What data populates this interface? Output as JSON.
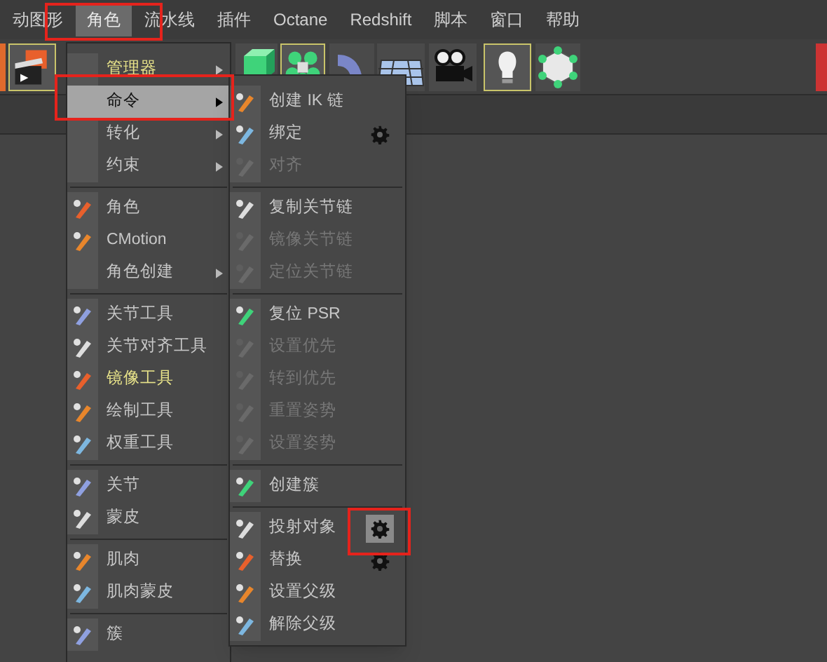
{
  "menubar": [
    {
      "label": "动图形",
      "selected": false
    },
    {
      "label": "角色",
      "selected": true
    },
    {
      "label": "流水线",
      "selected": false
    },
    {
      "label": "插件",
      "selected": false
    },
    {
      "label": "Octane",
      "selected": false
    },
    {
      "label": "Redshift",
      "selected": false
    },
    {
      "label": "脚本",
      "selected": false
    },
    {
      "label": "窗口",
      "selected": false
    },
    {
      "label": "帮助",
      "selected": false
    }
  ],
  "character_menu": [
    {
      "kind": "submenu",
      "label": "管理器",
      "selected": false,
      "accent": true
    },
    {
      "kind": "submenu",
      "label": "命令",
      "selected": true,
      "accent": false
    },
    {
      "kind": "submenu",
      "label": "转化",
      "selected": false,
      "accent": false
    },
    {
      "kind": "submenu",
      "label": "约束",
      "selected": false,
      "accent": false
    },
    {
      "kind": "separator"
    },
    {
      "kind": "command",
      "label": "角色",
      "selected": false,
      "accent": false
    },
    {
      "kind": "command",
      "label": "CMotion",
      "selected": false,
      "accent": false
    },
    {
      "kind": "submenu",
      "label": "角色创建",
      "selected": false,
      "accent": false
    },
    {
      "kind": "separator"
    },
    {
      "kind": "command",
      "label": "关节工具",
      "selected": false,
      "accent": false
    },
    {
      "kind": "command",
      "label": "关节对齐工具",
      "selected": false,
      "accent": false
    },
    {
      "kind": "command",
      "label": "镜像工具",
      "selected": false,
      "accent": true
    },
    {
      "kind": "command",
      "label": "绘制工具",
      "selected": false,
      "accent": false
    },
    {
      "kind": "command",
      "label": "权重工具",
      "selected": false,
      "accent": false
    },
    {
      "kind": "separator"
    },
    {
      "kind": "command",
      "label": "关节",
      "selected": false,
      "accent": false
    },
    {
      "kind": "command",
      "label": "蒙皮",
      "selected": false,
      "accent": false
    },
    {
      "kind": "separator"
    },
    {
      "kind": "command",
      "label": "肌肉",
      "selected": false,
      "accent": false
    },
    {
      "kind": "command",
      "label": "肌肉蒙皮",
      "selected": false,
      "accent": false
    },
    {
      "kind": "separator"
    },
    {
      "kind": "command",
      "label": "簇",
      "selected": false,
      "accent": false
    }
  ],
  "commands_submenu": [
    {
      "kind": "command",
      "label": "创建 IK 链",
      "disabled": false,
      "gear": false
    },
    {
      "kind": "command",
      "label": "绑定",
      "disabled": false,
      "gear": true,
      "gear_selected": false
    },
    {
      "kind": "command",
      "label": "对齐",
      "disabled": true,
      "gear": false
    },
    {
      "kind": "separator"
    },
    {
      "kind": "command",
      "label": "复制关节链",
      "disabled": false,
      "gear": false
    },
    {
      "kind": "command",
      "label": "镜像关节链",
      "disabled": true,
      "gear": false
    },
    {
      "kind": "command",
      "label": "定位关节链",
      "disabled": true,
      "gear": false
    },
    {
      "kind": "separator"
    },
    {
      "kind": "command",
      "label": "复位 PSR",
      "disabled": false,
      "gear": false
    },
    {
      "kind": "command",
      "label": "设置优先",
      "disabled": true,
      "gear": false
    },
    {
      "kind": "command",
      "label": "转到优先",
      "disabled": true,
      "gear": false
    },
    {
      "kind": "command",
      "label": "重置姿势",
      "disabled": true,
      "gear": false
    },
    {
      "kind": "command",
      "label": "设置姿势",
      "disabled": true,
      "gear": false
    },
    {
      "kind": "separator"
    },
    {
      "kind": "command",
      "label": "创建簇",
      "disabled": false,
      "gear": false
    },
    {
      "kind": "separator"
    },
    {
      "kind": "command",
      "label": "投射对象",
      "disabled": false,
      "gear": true,
      "gear_selected": true
    },
    {
      "kind": "command",
      "label": "替换",
      "disabled": false,
      "gear": true,
      "gear_selected": false
    },
    {
      "kind": "command",
      "label": "设置父级",
      "disabled": false,
      "gear": false
    },
    {
      "kind": "command",
      "label": "解除父级",
      "disabled": false,
      "gear": false
    }
  ]
}
